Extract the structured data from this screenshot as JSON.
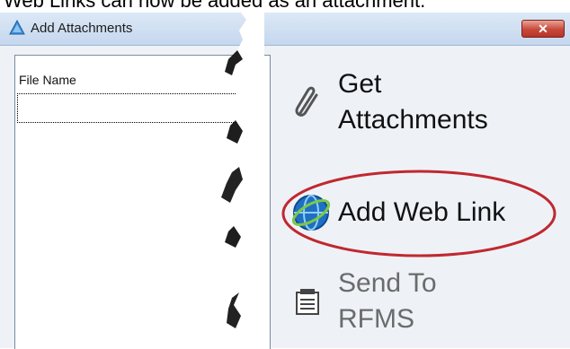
{
  "caption": "Web Links can now be added as an attachment.",
  "window": {
    "title": "Add Attachments",
    "close_symbol": "✕"
  },
  "file_list": {
    "column_header": "File Name"
  },
  "actions": [
    {
      "label_line1": "Get",
      "label_line2": "Attachments",
      "icon": "paperclip-icon",
      "enabled": true
    },
    {
      "label": "Add Web Link",
      "icon": "globe-icon",
      "enabled": true,
      "highlighted": true
    },
    {
      "label_line1": "Send To",
      "label_line2": "RFMS",
      "icon": "send-to-icon",
      "enabled": false
    }
  ],
  "colors": {
    "highlight_ellipse": "#c0282f",
    "title_bar": "#c5d7ee",
    "close_button": "#c8483a"
  }
}
